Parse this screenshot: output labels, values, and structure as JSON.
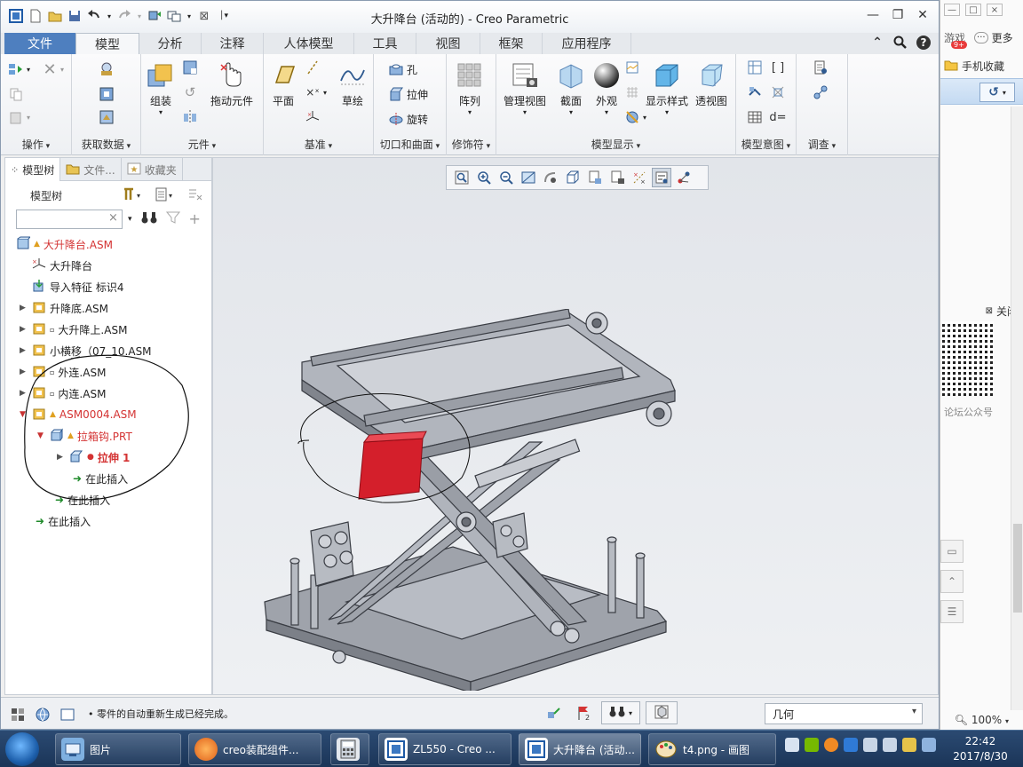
{
  "window": {
    "title": "大升降台 (活动的) - Creo Parametric"
  },
  "tabs": [
    "文件",
    "模型",
    "分析",
    "注释",
    "人体模型",
    "工具",
    "视图",
    "框架",
    "应用程序"
  ],
  "ribbon": {
    "groups": {
      "operations": "操作",
      "get_data": "获取数据",
      "component": "元件",
      "datum": "基准",
      "cut_surface": "切口和曲面",
      "modifiers": "修饰符",
      "model_display": "模型显示",
      "model_intent": "模型意图",
      "investigate": "调查"
    },
    "buttons": {
      "assemble": "组装",
      "drag_components": "拖动元件",
      "plane": "平面",
      "sketch": "草绘",
      "hole": "孔",
      "extrude": "拉伸",
      "revolve": "旋转",
      "pattern": "阵列",
      "manage_views": "管理视图",
      "section": "截面",
      "appearance": "外观",
      "display_style": "显示样式",
      "perspective": "透视图"
    }
  },
  "left_panel": {
    "tabs": [
      "模型树",
      "文件...",
      "收藏夹"
    ],
    "header": "模型树",
    "search_value": "",
    "tree": [
      {
        "label": "大升降台.ASM",
        "red": true
      },
      {
        "label": "大升降台",
        "red": false
      },
      {
        "label": "导入特征 标识4",
        "red": false
      },
      {
        "label": "升降底.ASM",
        "red": false
      },
      {
        "label": "大升降上.ASM",
        "red": false
      },
      {
        "label": "小横移（07_10.ASM",
        "red": false
      },
      {
        "label": "外连.ASM",
        "red": false
      },
      {
        "label": "内连.ASM",
        "red": false
      },
      {
        "label": "ASM0004.ASM",
        "red": true
      },
      {
        "label": "拉箱钩.PRT",
        "red": true
      },
      {
        "label": "拉伸 1",
        "red": true
      },
      {
        "label": "在此插入",
        "red": false
      },
      {
        "label": "在此插入",
        "red": false
      },
      {
        "label": "在此插入",
        "red": false
      }
    ]
  },
  "status": {
    "message": "零件的自动重新生成已经完成。",
    "filter": "几何"
  },
  "browser": {
    "games": "游戏",
    "badge": "9+",
    "more": "更多",
    "mobile_fav": "手机收藏",
    "close": "关闭",
    "forum": "论坛公众号",
    "zoom": "100%"
  },
  "taskbar": {
    "items": [
      "图片",
      "creo装配组件...",
      "ZL550 - Creo ...",
      "大升降台 (活动...",
      "t4.png - 画图"
    ],
    "time": "22:42",
    "date": "2017/8/30"
  }
}
